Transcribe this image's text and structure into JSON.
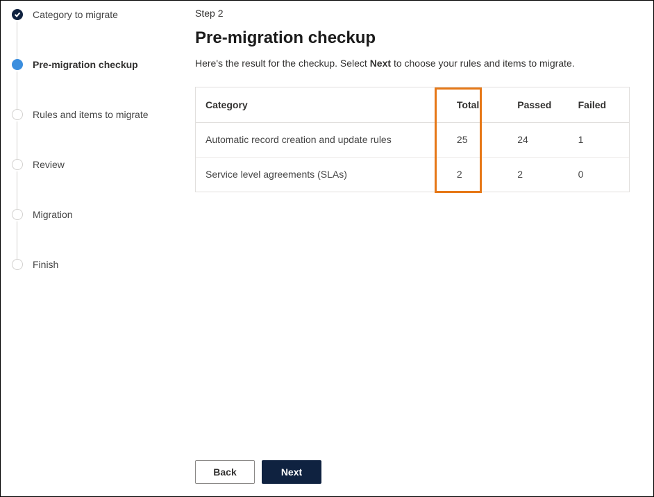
{
  "steps": {
    "s1": {
      "label": "Category to migrate"
    },
    "s2": {
      "label": "Pre-migration checkup"
    },
    "s3": {
      "label": "Rules and items to migrate"
    },
    "s4": {
      "label": "Review"
    },
    "s5": {
      "label": "Migration"
    },
    "s6": {
      "label": "Finish"
    }
  },
  "main": {
    "step_label": "Step 2",
    "title": "Pre-migration checkup",
    "desc_before": "Here's the result for the checkup. Select ",
    "desc_bold": "Next",
    "desc_after": " to choose your rules and items to migrate."
  },
  "table": {
    "headers": {
      "category": "Category",
      "total": "Total",
      "passed": "Passed",
      "failed": "Failed"
    },
    "rows": [
      {
        "category": "Automatic record creation and update rules",
        "total": "25",
        "passed": "24",
        "failed": "1"
      },
      {
        "category": "Service level agreements (SLAs)",
        "total": "2",
        "passed": "2",
        "failed": "0"
      }
    ]
  },
  "footer": {
    "back": "Back",
    "next": "Next"
  }
}
